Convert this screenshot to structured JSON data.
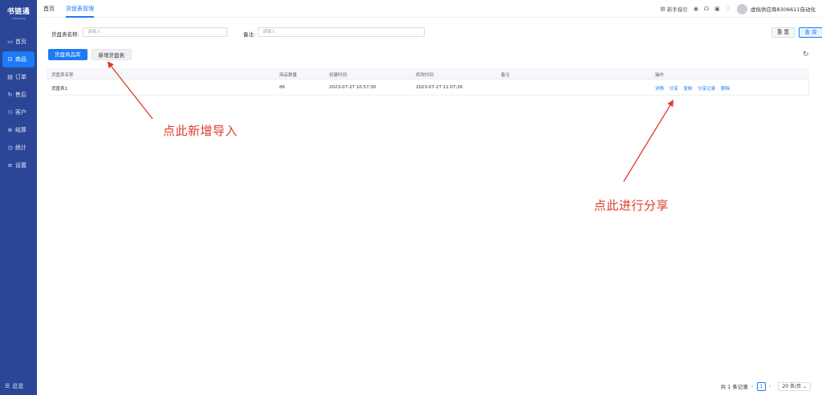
{
  "sidebar": {
    "logo": "书链通",
    "logo_sub": "shulian tong",
    "items": [
      {
        "label": "首页",
        "icon": "monitor-icon"
      },
      {
        "label": "商品",
        "icon": "bag-icon"
      },
      {
        "label": "订单",
        "icon": "document-icon"
      },
      {
        "label": "售后",
        "icon": "refresh-icon"
      },
      {
        "label": "客户",
        "icon": "users-icon"
      },
      {
        "label": "结算",
        "icon": "settlement-icon"
      },
      {
        "label": "统计",
        "icon": "clock-icon"
      },
      {
        "label": "设置",
        "icon": "settings-icon"
      }
    ],
    "active_index": 1,
    "bottom_label": "总览"
  },
  "topbar": {
    "tabs": [
      "首页",
      "货盘表管理"
    ],
    "active_tab": 1,
    "guide_label": "新手指引",
    "username": "虚拟供应商8306611自动化"
  },
  "search": {
    "name_label": "货盘表名称:",
    "name_placeholder": "请输入",
    "remark_label": "备注:",
    "remark_placeholder": "请输入",
    "reset_label": "重 置",
    "query_label": "查 询"
  },
  "actions": {
    "library_label": "货盘商品库",
    "new_label": "新增货盘表"
  },
  "table": {
    "headers": [
      "货盘表名称",
      "商品数量",
      "创建时间",
      "修改时间",
      "备注",
      "操作"
    ],
    "rows": [
      {
        "name": "货盘表1",
        "count": "86",
        "created": "2023-07-27 10:57:30",
        "modified": "2023-07-27 11:07:26",
        "remark": "",
        "ops": [
          "详情",
          "分享",
          "复制",
          "分享记录",
          "删除"
        ]
      }
    ]
  },
  "annotations": {
    "import_note": "点此新增导入",
    "share_note": "点此进行分享",
    "color": "#e03a2e"
  },
  "pagination": {
    "total": "共 1 条记录",
    "current": "1",
    "page_size": "20 条/页"
  },
  "colors": {
    "sidebar_bg": "#2c4697",
    "primary": "#1d7bf5"
  }
}
